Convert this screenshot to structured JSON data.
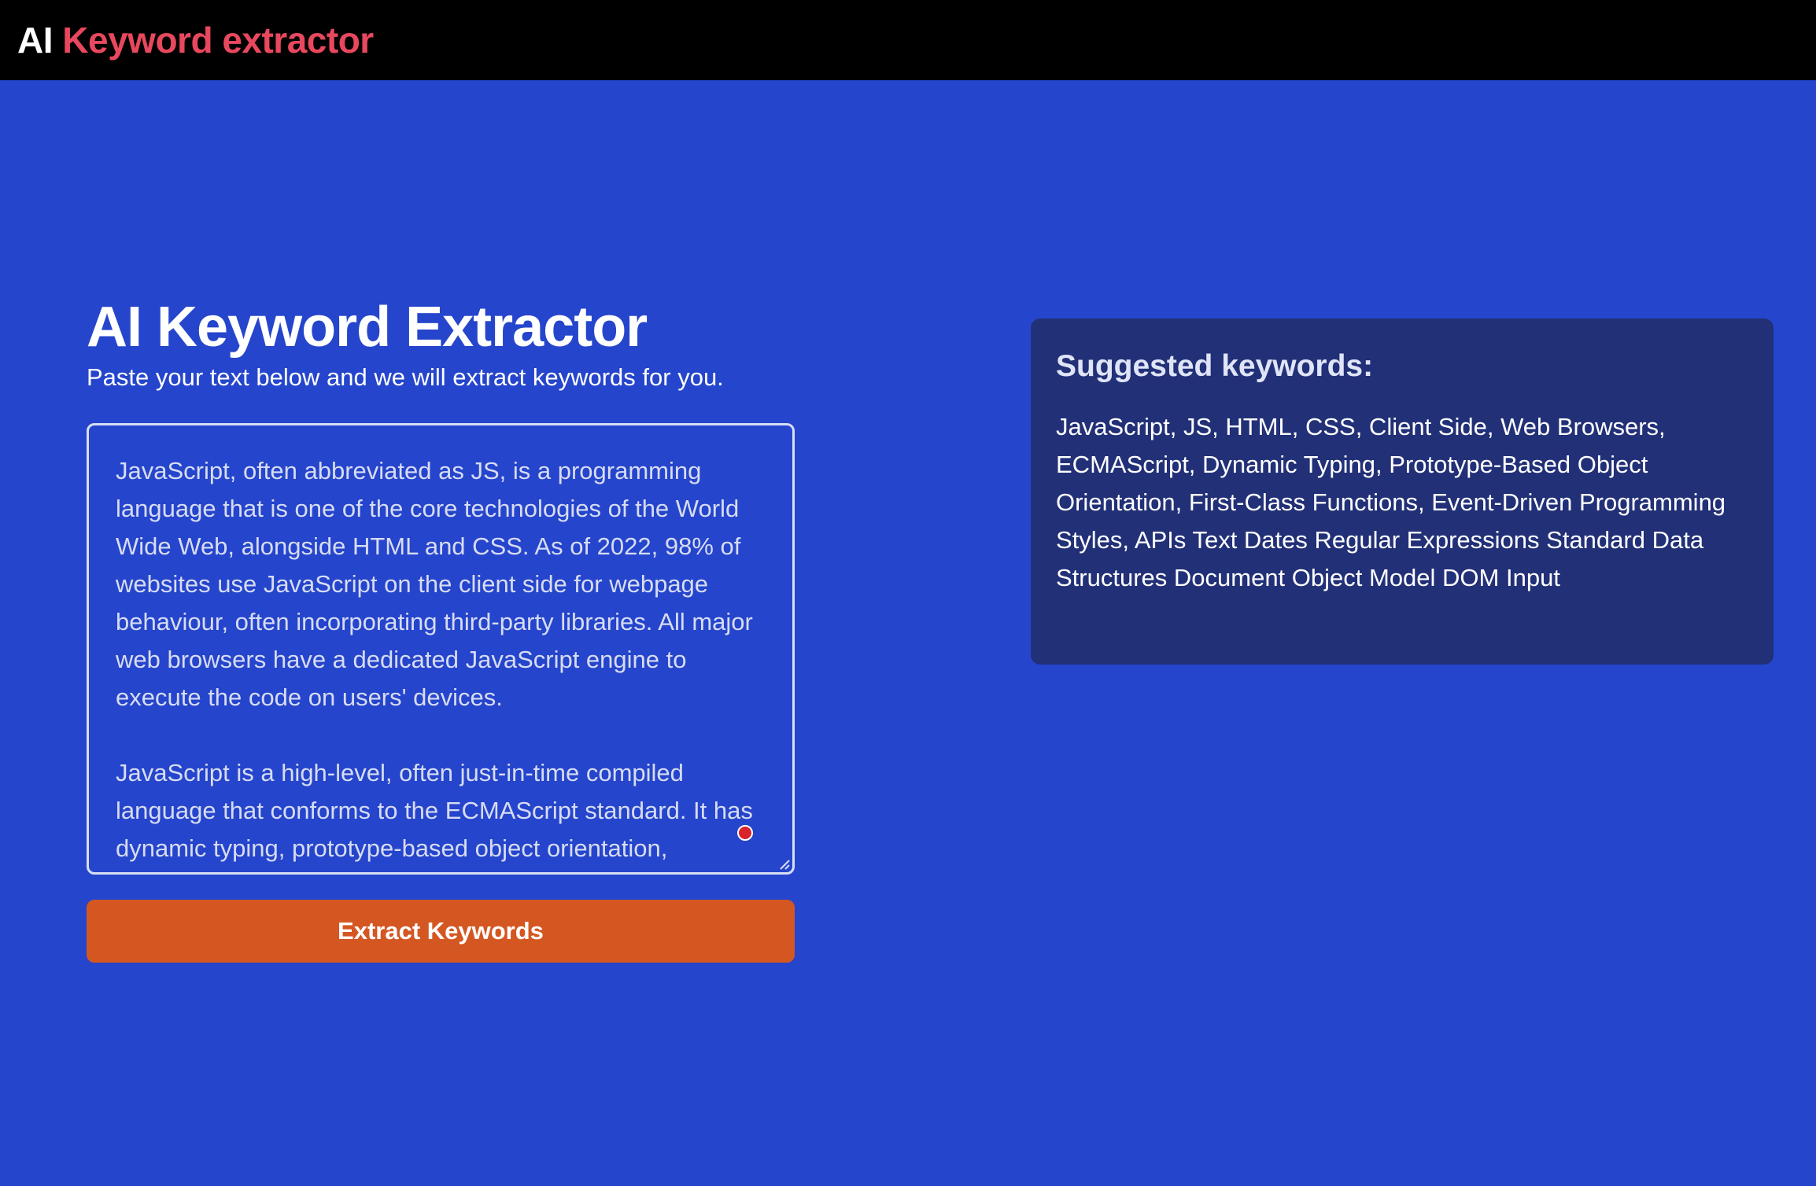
{
  "header": {
    "brand_prefix": "AI",
    "brand_name": "Keyword extractor"
  },
  "main": {
    "title": "AI Keyword Extractor",
    "subtitle": "Paste your text below and we will extract keywords for you.",
    "input_text": "JavaScript, often abbreviated as JS, is a programming language that is one of the core technologies of the World Wide Web, alongside HTML and CSS. As of 2022, 98% of websites use JavaScript on the client side for webpage behaviour, often incorporating third-party libraries. All major web browsers have a dedicated JavaScript engine to execute the code on users' devices.\n\nJavaScript is a high-level, often just-in-time compiled language that conforms to the ECMAScript standard. It has dynamic typing, prototype-based object orientation,",
    "extract_button_label": "Extract Keywords"
  },
  "results": {
    "title": "Suggested keywords:",
    "keywords_text": "JavaScript, JS, HTML, CSS, Client Side, Web Browsers, ECMAScript, Dynamic Typing, Prototype-Based Object Orientation, First-Class Functions, Event-Driven Programming Styles, APIs Text Dates Regular Expressions Standard Data Structures Document Object Model DOM Input"
  },
  "colors": {
    "background": "#2545cc",
    "topbar": "#000000",
    "brand_accent": "#e8485e",
    "button": "#d45722",
    "results_panel": "#223077"
  },
  "icons": {
    "cursor": "cursor-dot-icon",
    "resize": "resize-handle-icon"
  }
}
